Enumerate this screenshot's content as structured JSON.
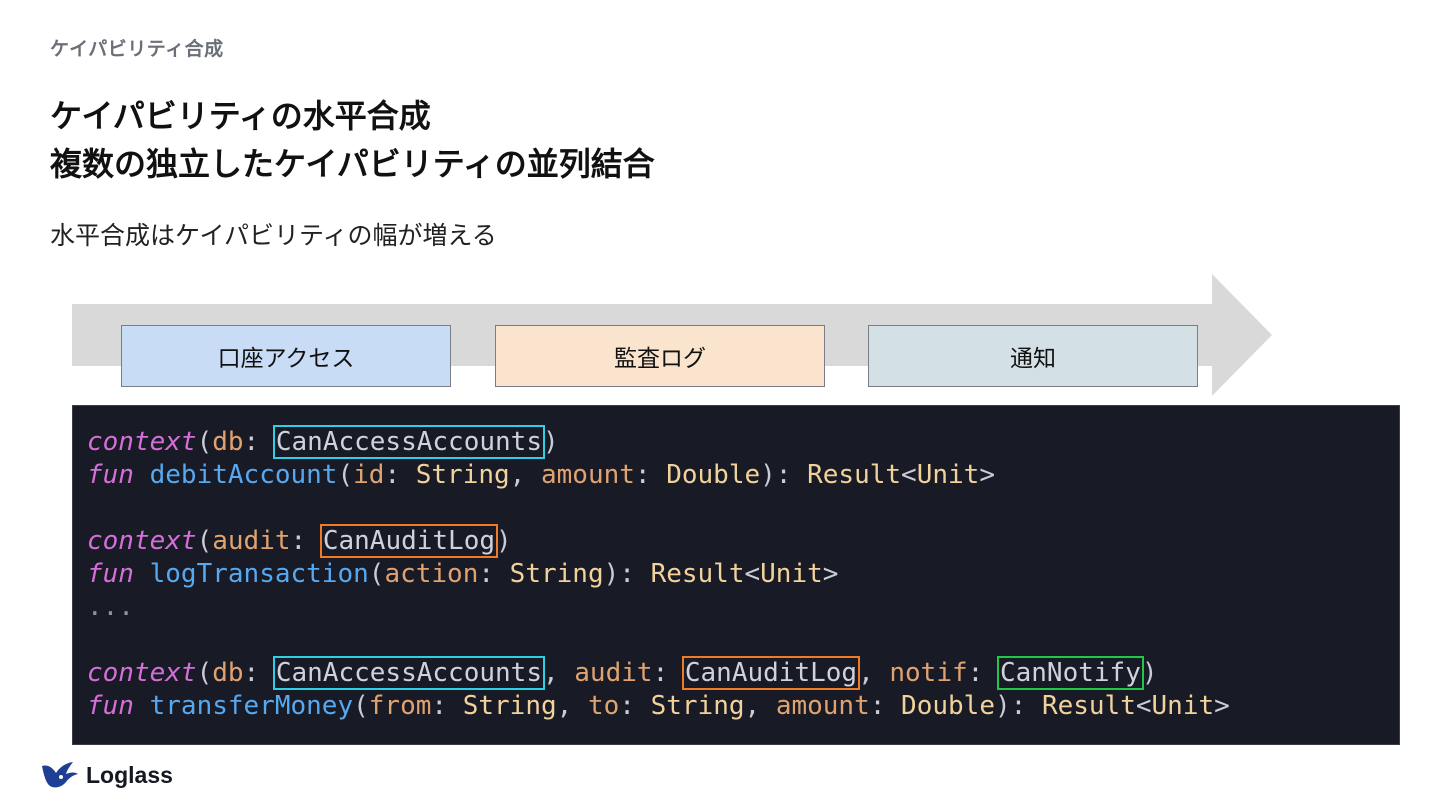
{
  "slide": {
    "eyebrow": "ケイパビリティ合成",
    "title_line1": "ケイパビリティの水平合成",
    "title_line2": "複数の独立したケイパビリティの並列結合",
    "subtitle": "水平合成はケイパビリティの幅が増える"
  },
  "capabilities": [
    {
      "label": "口座アクセス",
      "color": "#c9dcf5"
    },
    {
      "label": "監査ログ",
      "color": "#fbe4cd"
    },
    {
      "label": "通知",
      "color": "#d3e0e6"
    }
  ],
  "code": {
    "kw_context": "context",
    "kw_fun": "fun",
    "l1": {
      "param": "db",
      "type": "CanAccessAccounts"
    },
    "l2": {
      "name": "debitAccount",
      "p1": "id",
      "t1": "String",
      "p2": "amount",
      "t2": "Double",
      "ret": "Result",
      "ret_arg": "Unit"
    },
    "l4": {
      "param": "audit",
      "type": "CanAuditLog"
    },
    "l5": {
      "name": "logTransaction",
      "p1": "action",
      "t1": "String",
      "ret": "Result",
      "ret_arg": "Unit"
    },
    "l6": "...",
    "l8": {
      "p1": "db",
      "t1": "CanAccessAccounts",
      "p2": "audit",
      "t2": "CanAuditLog",
      "p3": "notif",
      "t3": "CanNotify"
    },
    "l9": {
      "name": "transferMoney",
      "p1": "from",
      "t1": "String",
      "p2": "to",
      "t2": "String",
      "p3": "amount",
      "t3": "Double",
      "ret": "Result",
      "ret_arg": "Unit"
    }
  },
  "logo": {
    "text": "Loglass",
    "icon": "bird-logo-icon"
  },
  "colors": {
    "code_bg": "#181a25",
    "keyword": "#d46fd8",
    "function": "#56a8f0",
    "param": "#e0a36f",
    "type": "#f2d29b",
    "highlight_cyan": "#2fd0e6",
    "highlight_orange": "#ee7b26",
    "highlight_green": "#22c845"
  }
}
